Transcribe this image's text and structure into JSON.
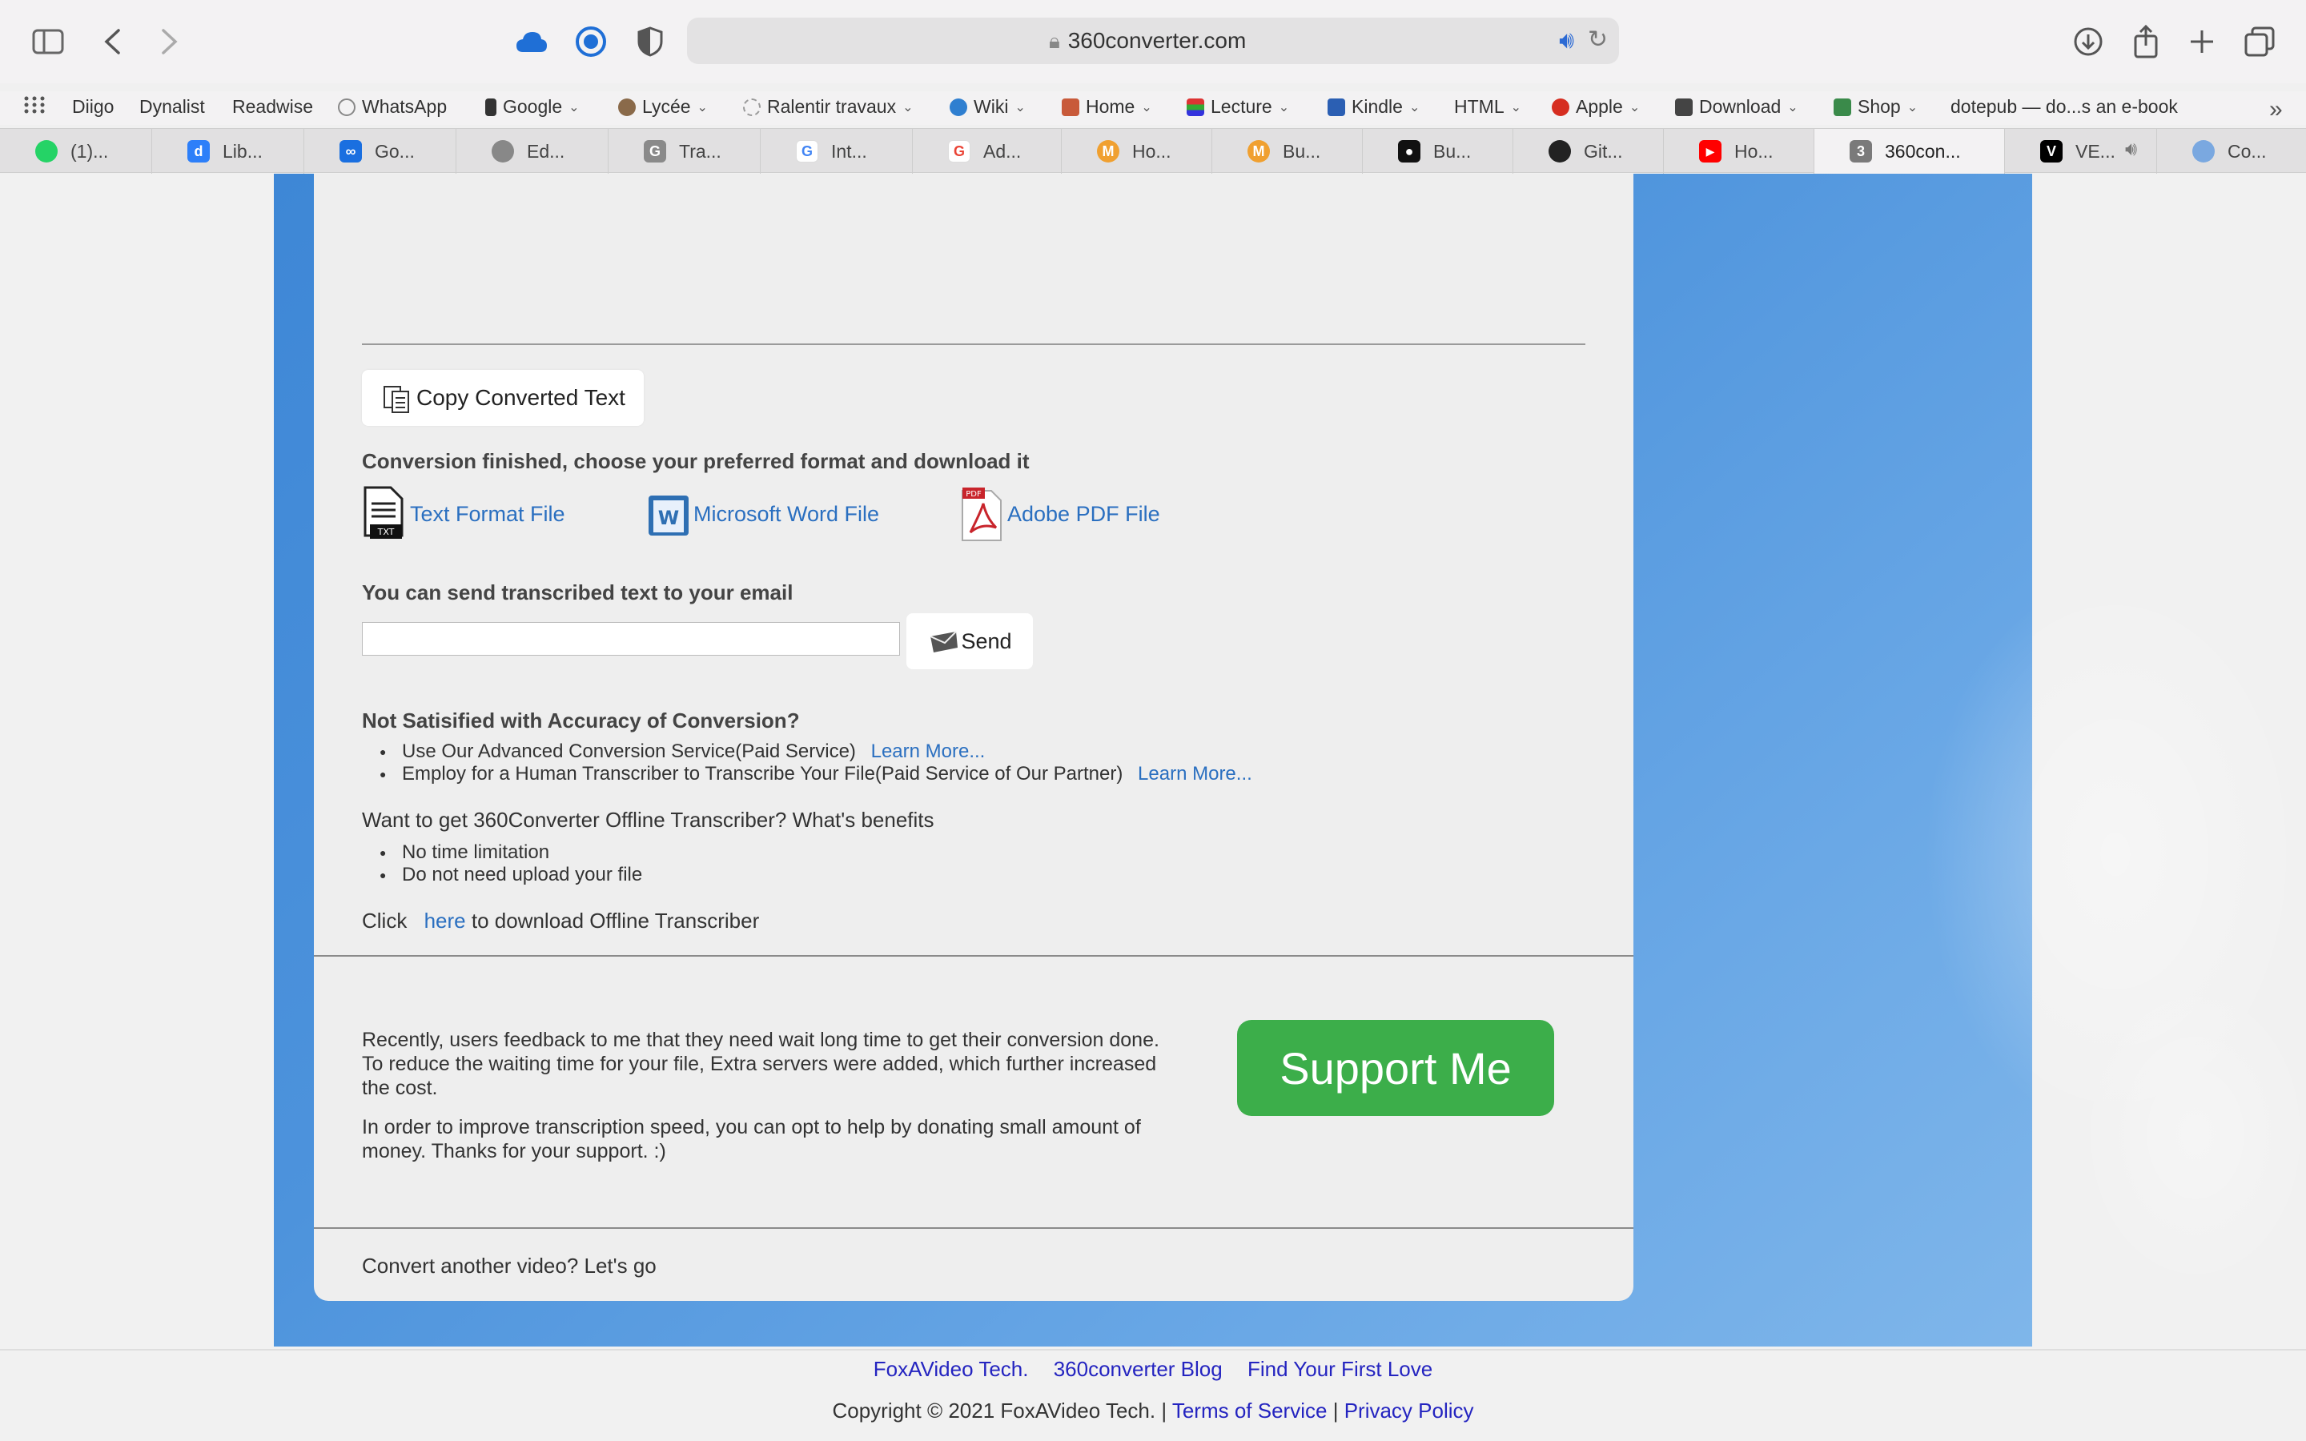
{
  "browser": {
    "url": "360converter.com",
    "bookmarks": [
      {
        "label": "Diigo"
      },
      {
        "label": "Dynalist"
      },
      {
        "label": "Readwise"
      },
      {
        "label": "WhatsApp"
      },
      {
        "label": "Google"
      },
      {
        "label": "Lycée"
      },
      {
        "label": "Ralentir travaux"
      },
      {
        "label": "Wiki"
      },
      {
        "label": "Home"
      },
      {
        "label": "Lecture"
      },
      {
        "label": "Kindle"
      },
      {
        "label": "HTML"
      },
      {
        "label": "Apple"
      },
      {
        "label": "Download"
      },
      {
        "label": "Shop"
      },
      {
        "label": "dotepub — do...s an e-book"
      }
    ],
    "tabs": [
      {
        "label": "(1)..."
      },
      {
        "label": "Lib..."
      },
      {
        "label": "Go..."
      },
      {
        "label": "Ed..."
      },
      {
        "label": "Tra..."
      },
      {
        "label": "Int..."
      },
      {
        "label": "Ad..."
      },
      {
        "label": "Ho..."
      },
      {
        "label": "Bu..."
      },
      {
        "label": "Bu..."
      },
      {
        "label": "Git..."
      },
      {
        "label": "Ho..."
      },
      {
        "label": "360con...",
        "badge": "3"
      },
      {
        "label": "VE..."
      },
      {
        "label": "Co..."
      }
    ]
  },
  "content": {
    "copy_button": "Copy Converted Text",
    "download_heading": "Conversion finished, choose your preferred format and download it",
    "downloads": [
      {
        "label": "Text Format File"
      },
      {
        "label": "Microsoft Word File"
      },
      {
        "label": "Adobe PDF File"
      }
    ],
    "email_heading": "You can send transcribed text to your email",
    "email_value": "",
    "send_button": "Send",
    "accuracy_heading": "Not Satisified with Accuracy of Conversion?",
    "accuracy_items": [
      {
        "text": "Use Our Advanced Conversion Service(Paid Service)",
        "link": "Learn More..."
      },
      {
        "text": "Employ for a Human Transcriber to Transcribe Your File(Paid Service of Our Partner)",
        "link": "Learn More..."
      }
    ],
    "offline_heading": "Want to get 360Converter Offline Transcriber? What's benefits",
    "offline_items": [
      "No time limitation",
      "Do not need upload your file"
    ],
    "click_prefix": "Click",
    "click_link": "here",
    "click_suffix": "to download Offline Transcriber",
    "support_para1": "Recently, users feedback to me that they need wait long time to get their conversion done. To reduce the waiting time for your file, Extra servers were added, which further increased the cost.",
    "support_para2": "In order to improve transcription speed, you can opt to help by donating small amount of money. Thanks for your support. :)",
    "support_button": "Support Me",
    "convert_another": "Convert another video? Let's go"
  },
  "footer": {
    "links": [
      "FoxAVideo Tech.",
      "360converter Blog",
      "Find Your First Love"
    ],
    "copyright": "Copyright © 2021 FoxAVideo Tech. |",
    "terms": "Terms of Service",
    "sep": "|",
    "privacy": "Privacy Policy"
  },
  "colors": {
    "accent_link": "#2a6fc0",
    "support_green": "#3cae4a",
    "bg_blue": "#4d93dc"
  }
}
